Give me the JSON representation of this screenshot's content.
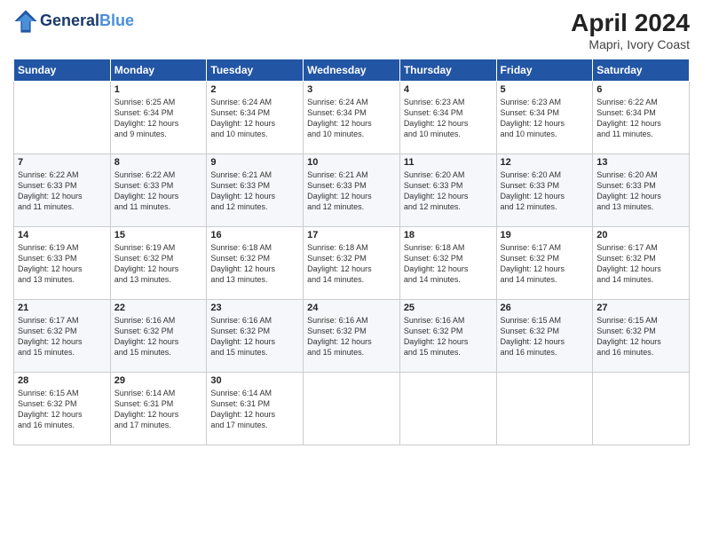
{
  "header": {
    "logo_line1": "General",
    "logo_line2": "Blue",
    "month": "April 2024",
    "location": "Mapri, Ivory Coast"
  },
  "weekdays": [
    "Sunday",
    "Monday",
    "Tuesday",
    "Wednesday",
    "Thursday",
    "Friday",
    "Saturday"
  ],
  "weeks": [
    [
      {
        "day": "",
        "info": ""
      },
      {
        "day": "1",
        "info": "Sunrise: 6:25 AM\nSunset: 6:34 PM\nDaylight: 12 hours\nand 9 minutes."
      },
      {
        "day": "2",
        "info": "Sunrise: 6:24 AM\nSunset: 6:34 PM\nDaylight: 12 hours\nand 10 minutes."
      },
      {
        "day": "3",
        "info": "Sunrise: 6:24 AM\nSunset: 6:34 PM\nDaylight: 12 hours\nand 10 minutes."
      },
      {
        "day": "4",
        "info": "Sunrise: 6:23 AM\nSunset: 6:34 PM\nDaylight: 12 hours\nand 10 minutes."
      },
      {
        "day": "5",
        "info": "Sunrise: 6:23 AM\nSunset: 6:34 PM\nDaylight: 12 hours\nand 10 minutes."
      },
      {
        "day": "6",
        "info": "Sunrise: 6:22 AM\nSunset: 6:34 PM\nDaylight: 12 hours\nand 11 minutes."
      }
    ],
    [
      {
        "day": "7",
        "info": "Sunrise: 6:22 AM\nSunset: 6:33 PM\nDaylight: 12 hours\nand 11 minutes."
      },
      {
        "day": "8",
        "info": "Sunrise: 6:22 AM\nSunset: 6:33 PM\nDaylight: 12 hours\nand 11 minutes."
      },
      {
        "day": "9",
        "info": "Sunrise: 6:21 AM\nSunset: 6:33 PM\nDaylight: 12 hours\nand 12 minutes."
      },
      {
        "day": "10",
        "info": "Sunrise: 6:21 AM\nSunset: 6:33 PM\nDaylight: 12 hours\nand 12 minutes."
      },
      {
        "day": "11",
        "info": "Sunrise: 6:20 AM\nSunset: 6:33 PM\nDaylight: 12 hours\nand 12 minutes."
      },
      {
        "day": "12",
        "info": "Sunrise: 6:20 AM\nSunset: 6:33 PM\nDaylight: 12 hours\nand 12 minutes."
      },
      {
        "day": "13",
        "info": "Sunrise: 6:20 AM\nSunset: 6:33 PM\nDaylight: 12 hours\nand 13 minutes."
      }
    ],
    [
      {
        "day": "14",
        "info": "Sunrise: 6:19 AM\nSunset: 6:33 PM\nDaylight: 12 hours\nand 13 minutes."
      },
      {
        "day": "15",
        "info": "Sunrise: 6:19 AM\nSunset: 6:32 PM\nDaylight: 12 hours\nand 13 minutes."
      },
      {
        "day": "16",
        "info": "Sunrise: 6:18 AM\nSunset: 6:32 PM\nDaylight: 12 hours\nand 13 minutes."
      },
      {
        "day": "17",
        "info": "Sunrise: 6:18 AM\nSunset: 6:32 PM\nDaylight: 12 hours\nand 14 minutes."
      },
      {
        "day": "18",
        "info": "Sunrise: 6:18 AM\nSunset: 6:32 PM\nDaylight: 12 hours\nand 14 minutes."
      },
      {
        "day": "19",
        "info": "Sunrise: 6:17 AM\nSunset: 6:32 PM\nDaylight: 12 hours\nand 14 minutes."
      },
      {
        "day": "20",
        "info": "Sunrise: 6:17 AM\nSunset: 6:32 PM\nDaylight: 12 hours\nand 14 minutes."
      }
    ],
    [
      {
        "day": "21",
        "info": "Sunrise: 6:17 AM\nSunset: 6:32 PM\nDaylight: 12 hours\nand 15 minutes."
      },
      {
        "day": "22",
        "info": "Sunrise: 6:16 AM\nSunset: 6:32 PM\nDaylight: 12 hours\nand 15 minutes."
      },
      {
        "day": "23",
        "info": "Sunrise: 6:16 AM\nSunset: 6:32 PM\nDaylight: 12 hours\nand 15 minutes."
      },
      {
        "day": "24",
        "info": "Sunrise: 6:16 AM\nSunset: 6:32 PM\nDaylight: 12 hours\nand 15 minutes."
      },
      {
        "day": "25",
        "info": "Sunrise: 6:16 AM\nSunset: 6:32 PM\nDaylight: 12 hours\nand 15 minutes."
      },
      {
        "day": "26",
        "info": "Sunrise: 6:15 AM\nSunset: 6:32 PM\nDaylight: 12 hours\nand 16 minutes."
      },
      {
        "day": "27",
        "info": "Sunrise: 6:15 AM\nSunset: 6:32 PM\nDaylight: 12 hours\nand 16 minutes."
      }
    ],
    [
      {
        "day": "28",
        "info": "Sunrise: 6:15 AM\nSunset: 6:32 PM\nDaylight: 12 hours\nand 16 minutes."
      },
      {
        "day": "29",
        "info": "Sunrise: 6:14 AM\nSunset: 6:31 PM\nDaylight: 12 hours\nand 17 minutes."
      },
      {
        "day": "30",
        "info": "Sunrise: 6:14 AM\nSunset: 6:31 PM\nDaylight: 12 hours\nand 17 minutes."
      },
      {
        "day": "",
        "info": ""
      },
      {
        "day": "",
        "info": ""
      },
      {
        "day": "",
        "info": ""
      },
      {
        "day": "",
        "info": ""
      }
    ]
  ]
}
